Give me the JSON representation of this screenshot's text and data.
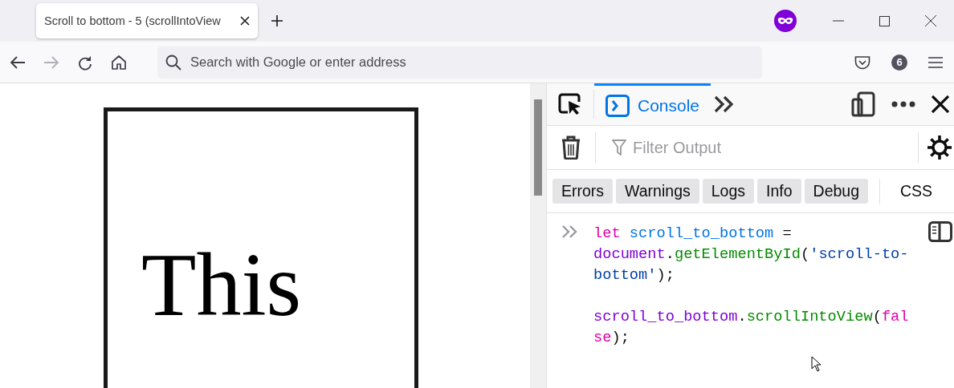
{
  "browser_tab": {
    "title": "Scroll to bottom - 5 (scrollIntoView",
    "selected": true
  },
  "address_bar": {
    "placeholder": "Search with Google or enter address"
  },
  "extensions_badge": "6",
  "page": {
    "text": "This"
  },
  "devtools": {
    "tabs": [
      {
        "label": "Console",
        "selected": true
      }
    ],
    "filter": {
      "placeholder": "Filter Output"
    },
    "levels": [
      {
        "label": "Errors",
        "selected": true
      },
      {
        "label": "Warnings",
        "selected": true
      },
      {
        "label": "Logs",
        "selected": true
      },
      {
        "label": "Info",
        "selected": true
      },
      {
        "label": "Debug",
        "selected": true
      },
      {
        "label": "CSS",
        "selected": false
      }
    ],
    "console_input": [
      [
        {
          "kind": "keyword",
          "text": "let"
        },
        {
          "kind": "decl",
          "text": " scroll_to_bottom"
        },
        {
          "kind": "punct",
          "text": " = "
        },
        {
          "kind": "var",
          "text": "document"
        },
        {
          "kind": "punct",
          "text": "."
        },
        {
          "kind": "method",
          "text": "getElementById"
        },
        {
          "kind": "punct",
          "text": "("
        },
        {
          "kind": "string",
          "text": "'scroll-to-bottom'"
        },
        {
          "kind": "punct",
          "text": ");"
        }
      ],
      [
        {
          "kind": "var",
          "text": "scroll_to_bottom"
        },
        {
          "kind": "punct",
          "text": "."
        },
        {
          "kind": "method",
          "text": "scrollIntoView"
        },
        {
          "kind": "punct",
          "text": "("
        },
        {
          "kind": "keyword",
          "text": "false"
        },
        {
          "kind": "punct",
          "text": ");"
        }
      ]
    ]
  }
}
